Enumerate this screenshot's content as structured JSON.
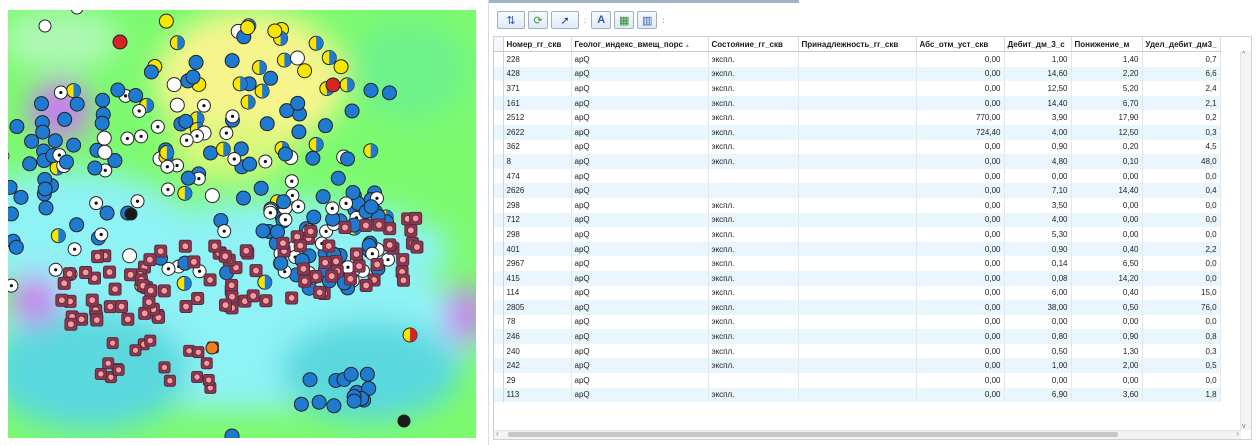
{
  "map": {
    "colors": {
      "white": "#ffffff",
      "blue": "#1f7bd2",
      "yellow": "#f8e600",
      "red": "#d42424",
      "black": "#1a1a1a",
      "orange": "#f07d1e",
      "maroon": "#8b3a55",
      "pink": "#ff9a9a"
    },
    "background_colors": {
      "green": "#7cfa70",
      "yellow": "#f6f58c",
      "cyan": "#8ff2f4",
      "teal": "#5ad8de",
      "purple": "#c97cf0"
    }
  },
  "toolbar": {
    "icons": [
      "arrange-icon",
      "refresh-icon",
      "select-pointer-icon",
      "text-tool-icon",
      "add-table-icon",
      "info-icon"
    ],
    "separator": ":"
  },
  "table": {
    "columns": [
      "Номер_гг_скв",
      "Геолог_индекс_вмещ_порс",
      "Состояние_гг_скв",
      "Принадлежность_гг_скв",
      "Абс_отм_уст_скв",
      "Дебит_дм_3_с",
      "Понижение_м",
      "Удел_дебит_дм3_"
    ],
    "sort_indicator": "▲",
    "rows": [
      [
        "228",
        "apQ",
        "экспл.",
        "",
        "0,00",
        "1,00",
        "1,40",
        "0,7"
      ],
      [
        "428",
        "apQ",
        "экспл.",
        "",
        "0,00",
        "14,60",
        "2,20",
        "6,6"
      ],
      [
        "371",
        "apQ",
        "экспл.",
        "",
        "0,00",
        "12,50",
        "5,20",
        "2,4"
      ],
      [
        "161",
        "apQ",
        "экспл.",
        "",
        "0,00",
        "14,40",
        "6,70",
        "2,1"
      ],
      [
        "2512",
        "apQ",
        "экспл.",
        "",
        "770,00",
        "3,90",
        "17,90",
        "0,2"
      ],
      [
        "2622",
        "apQ",
        "экспл.",
        "",
        "724,40",
        "4,00",
        "12,50",
        "0,3"
      ],
      [
        "362",
        "apQ",
        "экспл.",
        "",
        "0,00",
        "0,90",
        "0,20",
        "4,5"
      ],
      [
        "8",
        "apQ",
        "экспл.",
        "",
        "0,00",
        "4,80",
        "0,10",
        "48,0"
      ],
      [
        "474",
        "apQ",
        "",
        "",
        "0,00",
        "0,00",
        "0,00",
        "0,0"
      ],
      [
        "2626",
        "apQ",
        "",
        "",
        "0,00",
        "7,10",
        "14,40",
        "0,4"
      ],
      [
        "298",
        "apQ",
        "экспл.",
        "",
        "0,00",
        "3,50",
        "0,00",
        "0,0"
      ],
      [
        "712",
        "apQ",
        "экспл.",
        "",
        "0,00",
        "4,00",
        "0,00",
        "0,0"
      ],
      [
        "298",
        "apQ",
        "экспл.",
        "",
        "0,00",
        "5,30",
        "0,00",
        "0,0"
      ],
      [
        "401",
        "apQ",
        "экспл.",
        "",
        "0,00",
        "0,90",
        "0,40",
        "2,2"
      ],
      [
        "2967",
        "apQ",
        "экспл.",
        "",
        "0,00",
        "0,14",
        "6,50",
        "0,0"
      ],
      [
        "415",
        "apQ",
        "экспл.",
        "",
        "0,00",
        "0,08",
        "14,20",
        "0,0"
      ],
      [
        "114",
        "apQ",
        "экспл.",
        "",
        "0,00",
        "6,00",
        "0,40",
        "15,0"
      ],
      [
        "2805",
        "apQ",
        "экспл.",
        "",
        "0,00",
        "38,00",
        "0,50",
        "76,0"
      ],
      [
        "78",
        "apQ",
        "экспл.",
        "",
        "0,00",
        "0,00",
        "0,00",
        "0,0"
      ],
      [
        "246",
        "apQ",
        "экспл.",
        "",
        "0,00",
        "0,80",
        "0,90",
        "0,8"
      ],
      [
        "240",
        "apQ",
        "экспл.",
        "",
        "0,00",
        "0,50",
        "1,30",
        "0,3"
      ],
      [
        "242",
        "apQ",
        "экспл.",
        "",
        "0,00",
        "1,00",
        "2,00",
        "0,5"
      ],
      [
        "29",
        "apQ",
        "",
        "",
        "0,00",
        "0,00",
        "0,00",
        "0,0"
      ],
      [
        "113",
        "apQ",
        "экспл.",
        "",
        "0,00",
        "6,90",
        "3,60",
        "1,8"
      ]
    ]
  }
}
